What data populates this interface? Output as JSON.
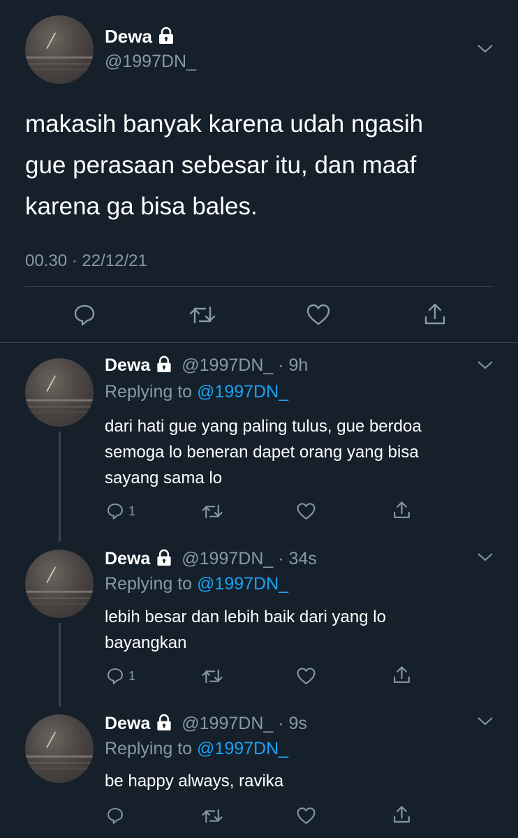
{
  "main_tweet": {
    "name": "Dewa",
    "handle": "@1997DN_",
    "text_lines": [
      "makasih banyak karena udah ngasih",
      "gue perasaan sebesar itu, dan maaf",
      "karena ga bisa bales."
    ],
    "timestamp": "00.30 · 22/12/21"
  },
  "replies": [
    {
      "name": "Dewa",
      "handle_time": "@1997DN_ · 9h",
      "replying_prefix": "Replying to",
      "replying_to": "@1997DN_",
      "text_lines": [
        "dari hati gue yang paling tulus, gue berdoa",
        "semoga lo beneran dapet orang yang bisa",
        "sayang sama lo"
      ],
      "reply_count": "1"
    },
    {
      "name": "Dewa",
      "handle_time": "@1997DN_ · 34s",
      "replying_prefix": "Replying to",
      "replying_to": "@1997DN_",
      "text_lines": [
        "lebih besar dan lebih baik dari yang lo",
        "bayangkan"
      ],
      "reply_count": "1"
    },
    {
      "name": "Dewa",
      "handle_time": "@1997DN_ · 9s",
      "replying_prefix": "Replying to",
      "replying_to": "@1997DN_",
      "text_lines": [
        "be happy always, ravika"
      ],
      "reply_count": ""
    }
  ],
  "colors": {
    "background": "#15202b",
    "text": "#ffffff",
    "muted": "#8899a6",
    "link": "#1da1f2",
    "divider": "#38444d"
  },
  "icons": [
    "lock-icon",
    "chevron-down-icon",
    "reply-icon",
    "retweet-icon",
    "like-icon",
    "share-icon"
  ]
}
